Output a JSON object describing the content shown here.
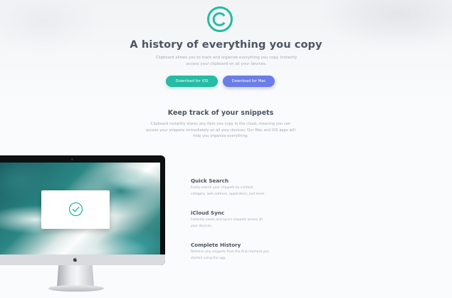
{
  "hero": {
    "title": "A history of everything you copy",
    "description": "Clipboard allows you to track and organize everything you copy. Instantly access your clipboard on all your devices.",
    "ios_button": "Download for iOS",
    "mac_button": "Download for Mac"
  },
  "snippets": {
    "title": "Keep track of your snippets",
    "description": "Clipboard instantly stores any item you copy in the cloud, meaning you can access your snippets immediately on all your devices. Our Mac and iOS apps will help you organize everything."
  },
  "features": [
    {
      "title": "Quick Search",
      "description": "Easily search your snippets by content, category, web address, application, and more."
    },
    {
      "title": "iCloud Sync",
      "description": "Instantly saves and syncs snippets across all your devices."
    },
    {
      "title": "Complete History",
      "description": "Retrieve any snippets from the first moment you started using the app."
    }
  ],
  "colors": {
    "accent_teal": "#26bba4",
    "accent_blue": "#6a7de8",
    "heading": "#4c5564",
    "body_text": "#a4a9b4"
  },
  "icons": {
    "logo": "copyright-circle-icon",
    "card": "check-circle-icon",
    "monitor": "apple-icon"
  }
}
